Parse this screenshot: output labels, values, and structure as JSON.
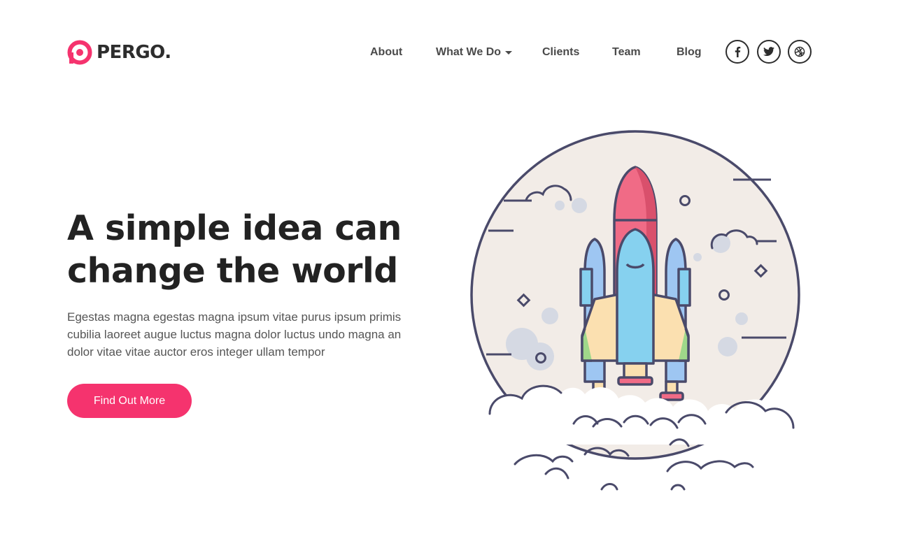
{
  "brand": {
    "name": "PERGO.",
    "accent_color": "#f5336e"
  },
  "nav": {
    "items": [
      {
        "label": "About"
      },
      {
        "label": "What We Do",
        "has_dropdown": true
      },
      {
        "label": "Clients"
      },
      {
        "label": "Team"
      },
      {
        "label": "Blog"
      }
    ]
  },
  "social": [
    {
      "icon": "facebook-icon"
    },
    {
      "icon": "twitter-icon"
    },
    {
      "icon": "dribbble-icon"
    }
  ],
  "hero": {
    "title_line1": "A simple idea can",
    "title_line2": "change the world",
    "description": "Egestas magna egestas magna ipsum vitae purus ipsum primis cubilia laoreet augue luctus magna dolor luctus undo magna an dolor vitae vitae auctor eros integer ullam tempor",
    "cta_label": "Find Out More"
  },
  "illustration": {
    "subject": "rocket-launch-illustration",
    "colors": {
      "outline": "#4a4a6a",
      "moon": "#f2ece7",
      "moon_shadow": "#d5d9e3",
      "rocket_center": "#f06b86",
      "booster": "#86d1ef",
      "wing": "#fbe0b0",
      "wing_trim": "#9fd88a",
      "side_booster": "#9ec6f2"
    }
  }
}
